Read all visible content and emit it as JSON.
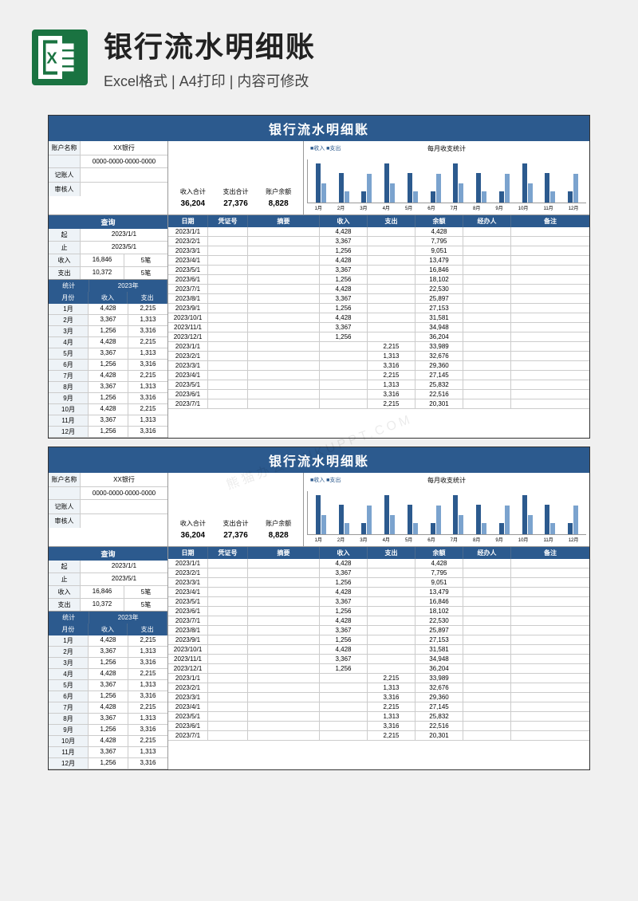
{
  "header": {
    "main_title": "银行流水明细账",
    "sub_title": "Excel格式 | A4打印 | 内容可修改"
  },
  "sheet": {
    "title": "银行流水明细账",
    "account": {
      "name_label": "账户名称",
      "name_value": "XX银行",
      "number_value": "0000-0000-0000-0000",
      "recorder_label": "记账人",
      "recorder_value": "",
      "auditor_label": "审核人",
      "auditor_value": ""
    },
    "totals": {
      "income_label": "收入合计",
      "income_value": "36,204",
      "expense_label": "支出合计",
      "expense_value": "27,376",
      "balance_label": "账户余额",
      "balance_value": "8,828"
    },
    "chart": {
      "title": "每月收支统计",
      "legend": "■收入 ■支出"
    },
    "query": {
      "header": "查询",
      "start_label": "起",
      "start_value": "2023/1/1",
      "end_label": "止",
      "end_value": "2023/5/1",
      "income_label": "收入",
      "income_value": "16,846",
      "income_count": "5笔",
      "expense_label": "支出",
      "expense_value": "10,372",
      "expense_count": "5笔"
    },
    "stats": {
      "header": "统计",
      "year": "2023年",
      "col_month": "月份",
      "col_income": "收入",
      "col_expense": "支出",
      "rows": [
        {
          "m": "1月",
          "i": "4,428",
          "e": "2,215"
        },
        {
          "m": "2月",
          "i": "3,367",
          "e": "1,313"
        },
        {
          "m": "3月",
          "i": "1,256",
          "e": "3,316"
        },
        {
          "m": "4月",
          "i": "4,428",
          "e": "2,215"
        },
        {
          "m": "5月",
          "i": "3,367",
          "e": "1,313"
        },
        {
          "m": "6月",
          "i": "1,256",
          "e": "3,316"
        },
        {
          "m": "7月",
          "i": "4,428",
          "e": "2,215"
        },
        {
          "m": "8月",
          "i": "3,367",
          "e": "1,313"
        },
        {
          "m": "9月",
          "i": "1,256",
          "e": "3,316"
        },
        {
          "m": "10月",
          "i": "4,428",
          "e": "2,215"
        },
        {
          "m": "11月",
          "i": "3,367",
          "e": "1,313"
        },
        {
          "m": "12月",
          "i": "1,256",
          "e": "3,316"
        }
      ]
    },
    "main": {
      "headers": {
        "date": "日期",
        "voucher": "凭证号",
        "summary": "摘要",
        "income": "收入",
        "expense": "支出",
        "balance": "余额",
        "handler": "经办人",
        "remark": "备注"
      },
      "rows": [
        {
          "d": "2023/1/1",
          "i": "4,428",
          "e": "",
          "b": "4,428"
        },
        {
          "d": "2023/2/1",
          "i": "3,367",
          "e": "",
          "b": "7,795"
        },
        {
          "d": "2023/3/1",
          "i": "1,256",
          "e": "",
          "b": "9,051"
        },
        {
          "d": "2023/4/1",
          "i": "4,428",
          "e": "",
          "b": "13,479"
        },
        {
          "d": "2023/5/1",
          "i": "3,367",
          "e": "",
          "b": "16,846"
        },
        {
          "d": "2023/6/1",
          "i": "1,256",
          "e": "",
          "b": "18,102"
        },
        {
          "d": "2023/7/1",
          "i": "4,428",
          "e": "",
          "b": "22,530"
        },
        {
          "d": "2023/8/1",
          "i": "3,367",
          "e": "",
          "b": "25,897"
        },
        {
          "d": "2023/9/1",
          "i": "1,256",
          "e": "",
          "b": "27,153"
        },
        {
          "d": "2023/10/1",
          "i": "4,428",
          "e": "",
          "b": "31,581"
        },
        {
          "d": "2023/11/1",
          "i": "3,367",
          "e": "",
          "b": "34,948"
        },
        {
          "d": "2023/12/1",
          "i": "1,256",
          "e": "",
          "b": "36,204"
        },
        {
          "d": "2023/1/1",
          "i": "",
          "e": "2,215",
          "b": "33,989"
        },
        {
          "d": "2023/2/1",
          "i": "",
          "e": "1,313",
          "b": "32,676"
        },
        {
          "d": "2023/3/1",
          "i": "",
          "e": "3,316",
          "b": "29,360"
        },
        {
          "d": "2023/4/1",
          "i": "",
          "e": "2,215",
          "b": "27,145"
        },
        {
          "d": "2023/5/1",
          "i": "",
          "e": "1,313",
          "b": "25,832"
        },
        {
          "d": "2023/6/1",
          "i": "",
          "e": "3,316",
          "b": "22,516"
        },
        {
          "d": "2023/7/1",
          "i": "",
          "e": "2,215",
          "b": "20,301"
        }
      ]
    }
  },
  "chart_data": {
    "type": "bar",
    "title": "每月收支统计",
    "categories": [
      "1月",
      "2月",
      "3月",
      "4月",
      "5月",
      "6月",
      "7月",
      "8月",
      "9月",
      "10月",
      "11月",
      "12月"
    ],
    "series": [
      {
        "name": "收入",
        "values": [
          4428,
          3367,
          1256,
          4428,
          3367,
          1256,
          4428,
          3367,
          1256,
          4428,
          3367,
          1256
        ]
      },
      {
        "name": "支出",
        "values": [
          2215,
          1313,
          3316,
          2215,
          1313,
          3316,
          2215,
          1313,
          3316,
          2215,
          1313,
          3316
        ]
      }
    ],
    "ylim": [
      0,
      5000
    ]
  },
  "watermark": "熊猫办公 TUKUPPT.COM"
}
